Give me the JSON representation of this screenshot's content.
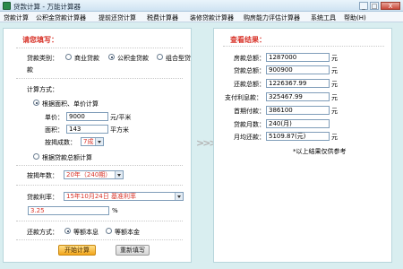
{
  "window": {
    "title": "贷款计算 - 万能计算器"
  },
  "menu": [
    "贷款计算",
    "公积金贷款计算器",
    "提前还贷计算",
    "税费计算器",
    "装修贷款计算器",
    "购房能力评估计算器",
    "系统工具",
    "帮助(H)"
  ],
  "window_buttons": {
    "minimize": "_",
    "maximize": "□",
    "close": "X"
  },
  "left": {
    "title": "请您填写：",
    "loan_type_label": "贷款类别：",
    "loan_types": [
      "商业贷款",
      "公积金贷款",
      "组合型贷"
    ],
    "loan_type_wrap": "款",
    "calc_method_label": "计算方式：",
    "by_area_label": "根据面积、单价计算",
    "unit_price_label": "单价：",
    "unit_price_value": "9000",
    "unit_price_unit": "元/平米",
    "area_label": "面积：",
    "area_value": "143",
    "area_unit": "平方米",
    "mortgage_ratio_label": "按揭成数：",
    "mortgage_ratio_value": "7成",
    "by_total_label": "根据贷款总额计算",
    "years_label": "按揭年数：",
    "years_value": "20年（240期）",
    "rate_label": "贷款利率：",
    "rate_option": "15年10月24日 基准利率",
    "rate_value": "3.25",
    "rate_unit": "%",
    "repay_label": "还款方式：",
    "repay_options": [
      "等额本息",
      "等额本金"
    ],
    "calc_button": "开始计算",
    "reset_button": "重新填写"
  },
  "right": {
    "title": "查看结果：",
    "rows": [
      {
        "label": "房款总额：",
        "value": "1287000",
        "unit": "元"
      },
      {
        "label": "贷款总额：",
        "value": "900900",
        "unit": "元"
      },
      {
        "label": "还款总额：",
        "value": "1226367.99",
        "unit": "元"
      },
      {
        "label": "支付利息款：",
        "value": "325467.99",
        "unit": "元"
      },
      {
        "label": "首期付款：",
        "value": "386100",
        "unit": "元"
      },
      {
        "label": "贷款月数：",
        "value": "240(月)",
        "unit": ""
      },
      {
        "label": "月均还款：",
        "value": "5109.87(元)",
        "unit": "元"
      }
    ],
    "note": "*以上结果仅供参考"
  },
  "colors": {
    "accent_red": "#d8342a",
    "panel_border": "#b8d6dc",
    "background": "#d9eef0"
  }
}
